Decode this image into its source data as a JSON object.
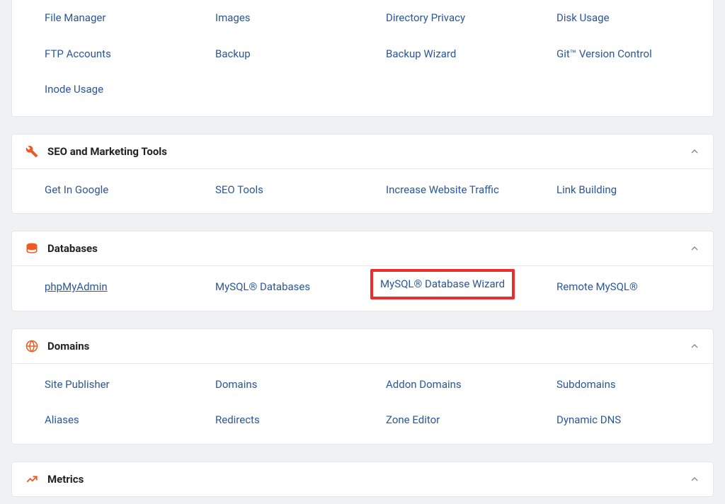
{
  "sections": [
    {
      "id": "files",
      "header": null,
      "items": [
        "File Manager",
        "Images",
        "Directory Privacy",
        "Disk Usage",
        "FTP Accounts",
        "Backup",
        "Backup Wizard",
        "Git™ Version Control",
        "Inode Usage"
      ]
    },
    {
      "id": "seo",
      "title": "SEO and Marketing Tools",
      "icon": "tools-icon",
      "items": [
        "Get In Google",
        "SEO Tools",
        "Increase Website Traffic",
        "Link Building"
      ]
    },
    {
      "id": "databases",
      "title": "Databases",
      "icon": "database-icon",
      "items": [
        "phpMyAdmin",
        "MySQL® Databases",
        "MySQL® Database Wizard",
        "Remote MySQL®"
      ],
      "underlined_index": 0,
      "highlighted_index": 2
    },
    {
      "id": "domains",
      "title": "Domains",
      "icon": "globe-icon",
      "items": [
        "Site Publisher",
        "Domains",
        "Addon Domains",
        "Subdomains",
        "Aliases",
        "Redirects",
        "Zone Editor",
        "Dynamic DNS"
      ]
    },
    {
      "id": "metrics",
      "title": "Metrics",
      "icon": "metrics-icon",
      "items": []
    }
  ]
}
